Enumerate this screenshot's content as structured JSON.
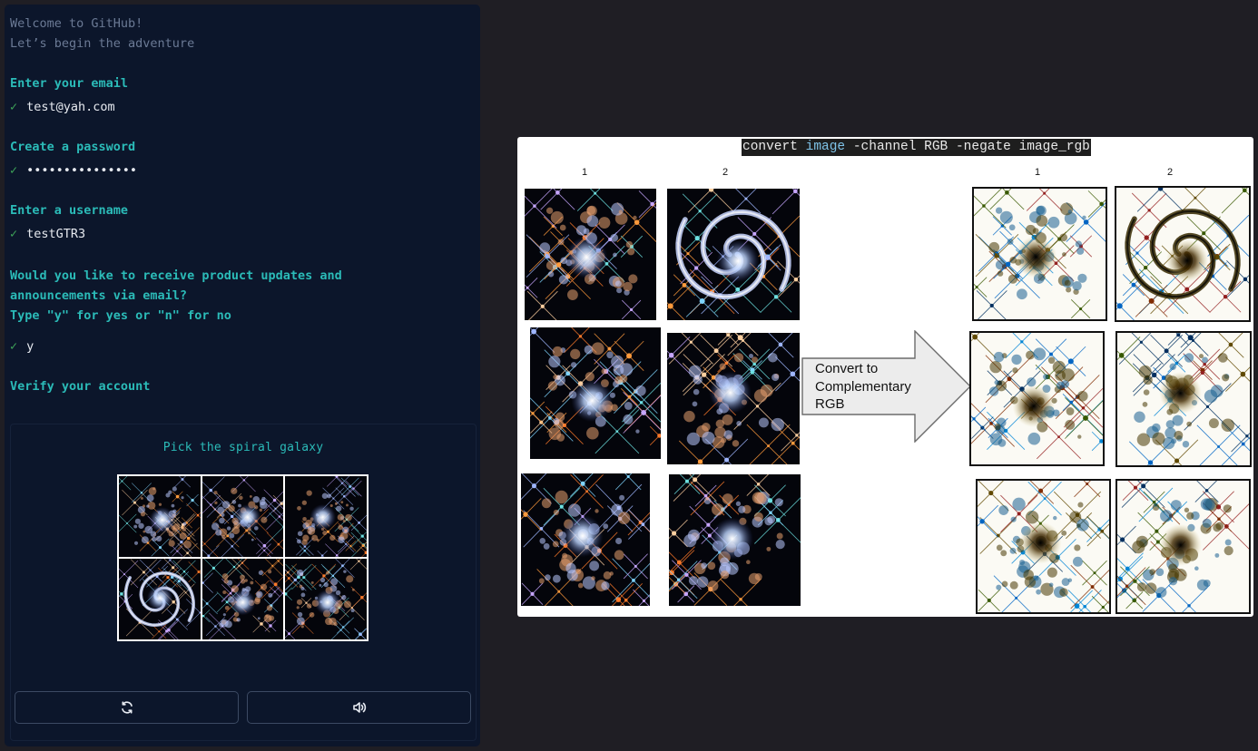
{
  "terminal": {
    "welcome": "Welcome to GitHub!",
    "subtitle": "Let’s begin the adventure",
    "steps": [
      {
        "prompt": "Enter your email",
        "value": "test@yah.com"
      },
      {
        "prompt": "Create a password",
        "value": "•••••••••••••••"
      },
      {
        "prompt": "Enter a username",
        "value": "testGTR3"
      },
      {
        "prompt_lines": [
          "Would you like to receive product updates and",
          "announcements via email?",
          "Type \"y\" for yes or \"n\" for no"
        ],
        "value": "y"
      }
    ],
    "check_mark": "✓",
    "verify_label": "Verify your account"
  },
  "captcha": {
    "title": "Pick the spiral galaxy",
    "tiles": [
      {
        "id": 1,
        "type": "irregular-galaxy"
      },
      {
        "id": 2,
        "type": "irregular-galaxy"
      },
      {
        "id": 3,
        "type": "irregular-galaxy"
      },
      {
        "id": 4,
        "type": "spiral-galaxy"
      },
      {
        "id": 5,
        "type": "irregular-galaxy"
      },
      {
        "id": 6,
        "type": "irregular-galaxy"
      }
    ],
    "buttons": [
      {
        "name": "refresh",
        "icon": "refresh-icon"
      },
      {
        "name": "audio",
        "icon": "speaker-icon"
      }
    ]
  },
  "figure": {
    "command_parts": [
      "convert ",
      "image",
      " -channel RGB -negate image_rgb"
    ],
    "left_column_labels": [
      "1",
      "2"
    ],
    "right_column_labels": [
      "1",
      "2"
    ],
    "arrow_label_lines": [
      "Convert to",
      "Complementary",
      "RGB"
    ],
    "original_images": [
      {
        "row": 1,
        "col": 1,
        "type": "irregular-galaxy"
      },
      {
        "row": 1,
        "col": 2,
        "type": "spiral-galaxy"
      },
      {
        "row": 2,
        "col": 1,
        "type": "irregular-galaxy"
      },
      {
        "row": 2,
        "col": 2,
        "type": "irregular-galaxy"
      },
      {
        "row": 3,
        "col": 1,
        "type": "irregular-galaxy"
      },
      {
        "row": 3,
        "col": 2,
        "type": "irregular-galaxy"
      }
    ],
    "negated_images": [
      {
        "row": 1,
        "col": 1,
        "type": "irregular-galaxy-negated"
      },
      {
        "row": 1,
        "col": 2,
        "type": "spiral-galaxy-negated"
      },
      {
        "row": 2,
        "col": 1,
        "type": "irregular-galaxy-negated"
      },
      {
        "row": 2,
        "col": 2,
        "type": "irregular-galaxy-negated"
      },
      {
        "row": 3,
        "col": 1,
        "type": "irregular-galaxy-negated"
      },
      {
        "row": 3,
        "col": 2,
        "type": "irregular-galaxy-negated"
      }
    ]
  }
}
